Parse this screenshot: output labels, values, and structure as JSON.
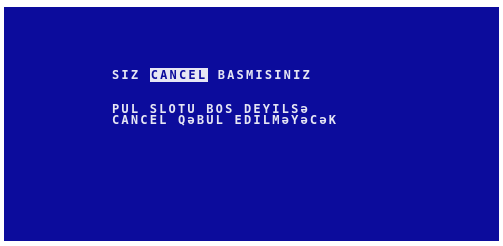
{
  "screen": {
    "colors": {
      "background": "#0c0c9c",
      "text": "#e6e6f4",
      "page": "#ffffff"
    },
    "line1": {
      "before": "SIZ ",
      "highlight": "CANCEL",
      "after": " BASMISINIZ"
    },
    "line2": "PUL SLOTU BOS DEYILSə",
    "line3": "CANCEL QəBUL EDILMəYəCəK"
  }
}
